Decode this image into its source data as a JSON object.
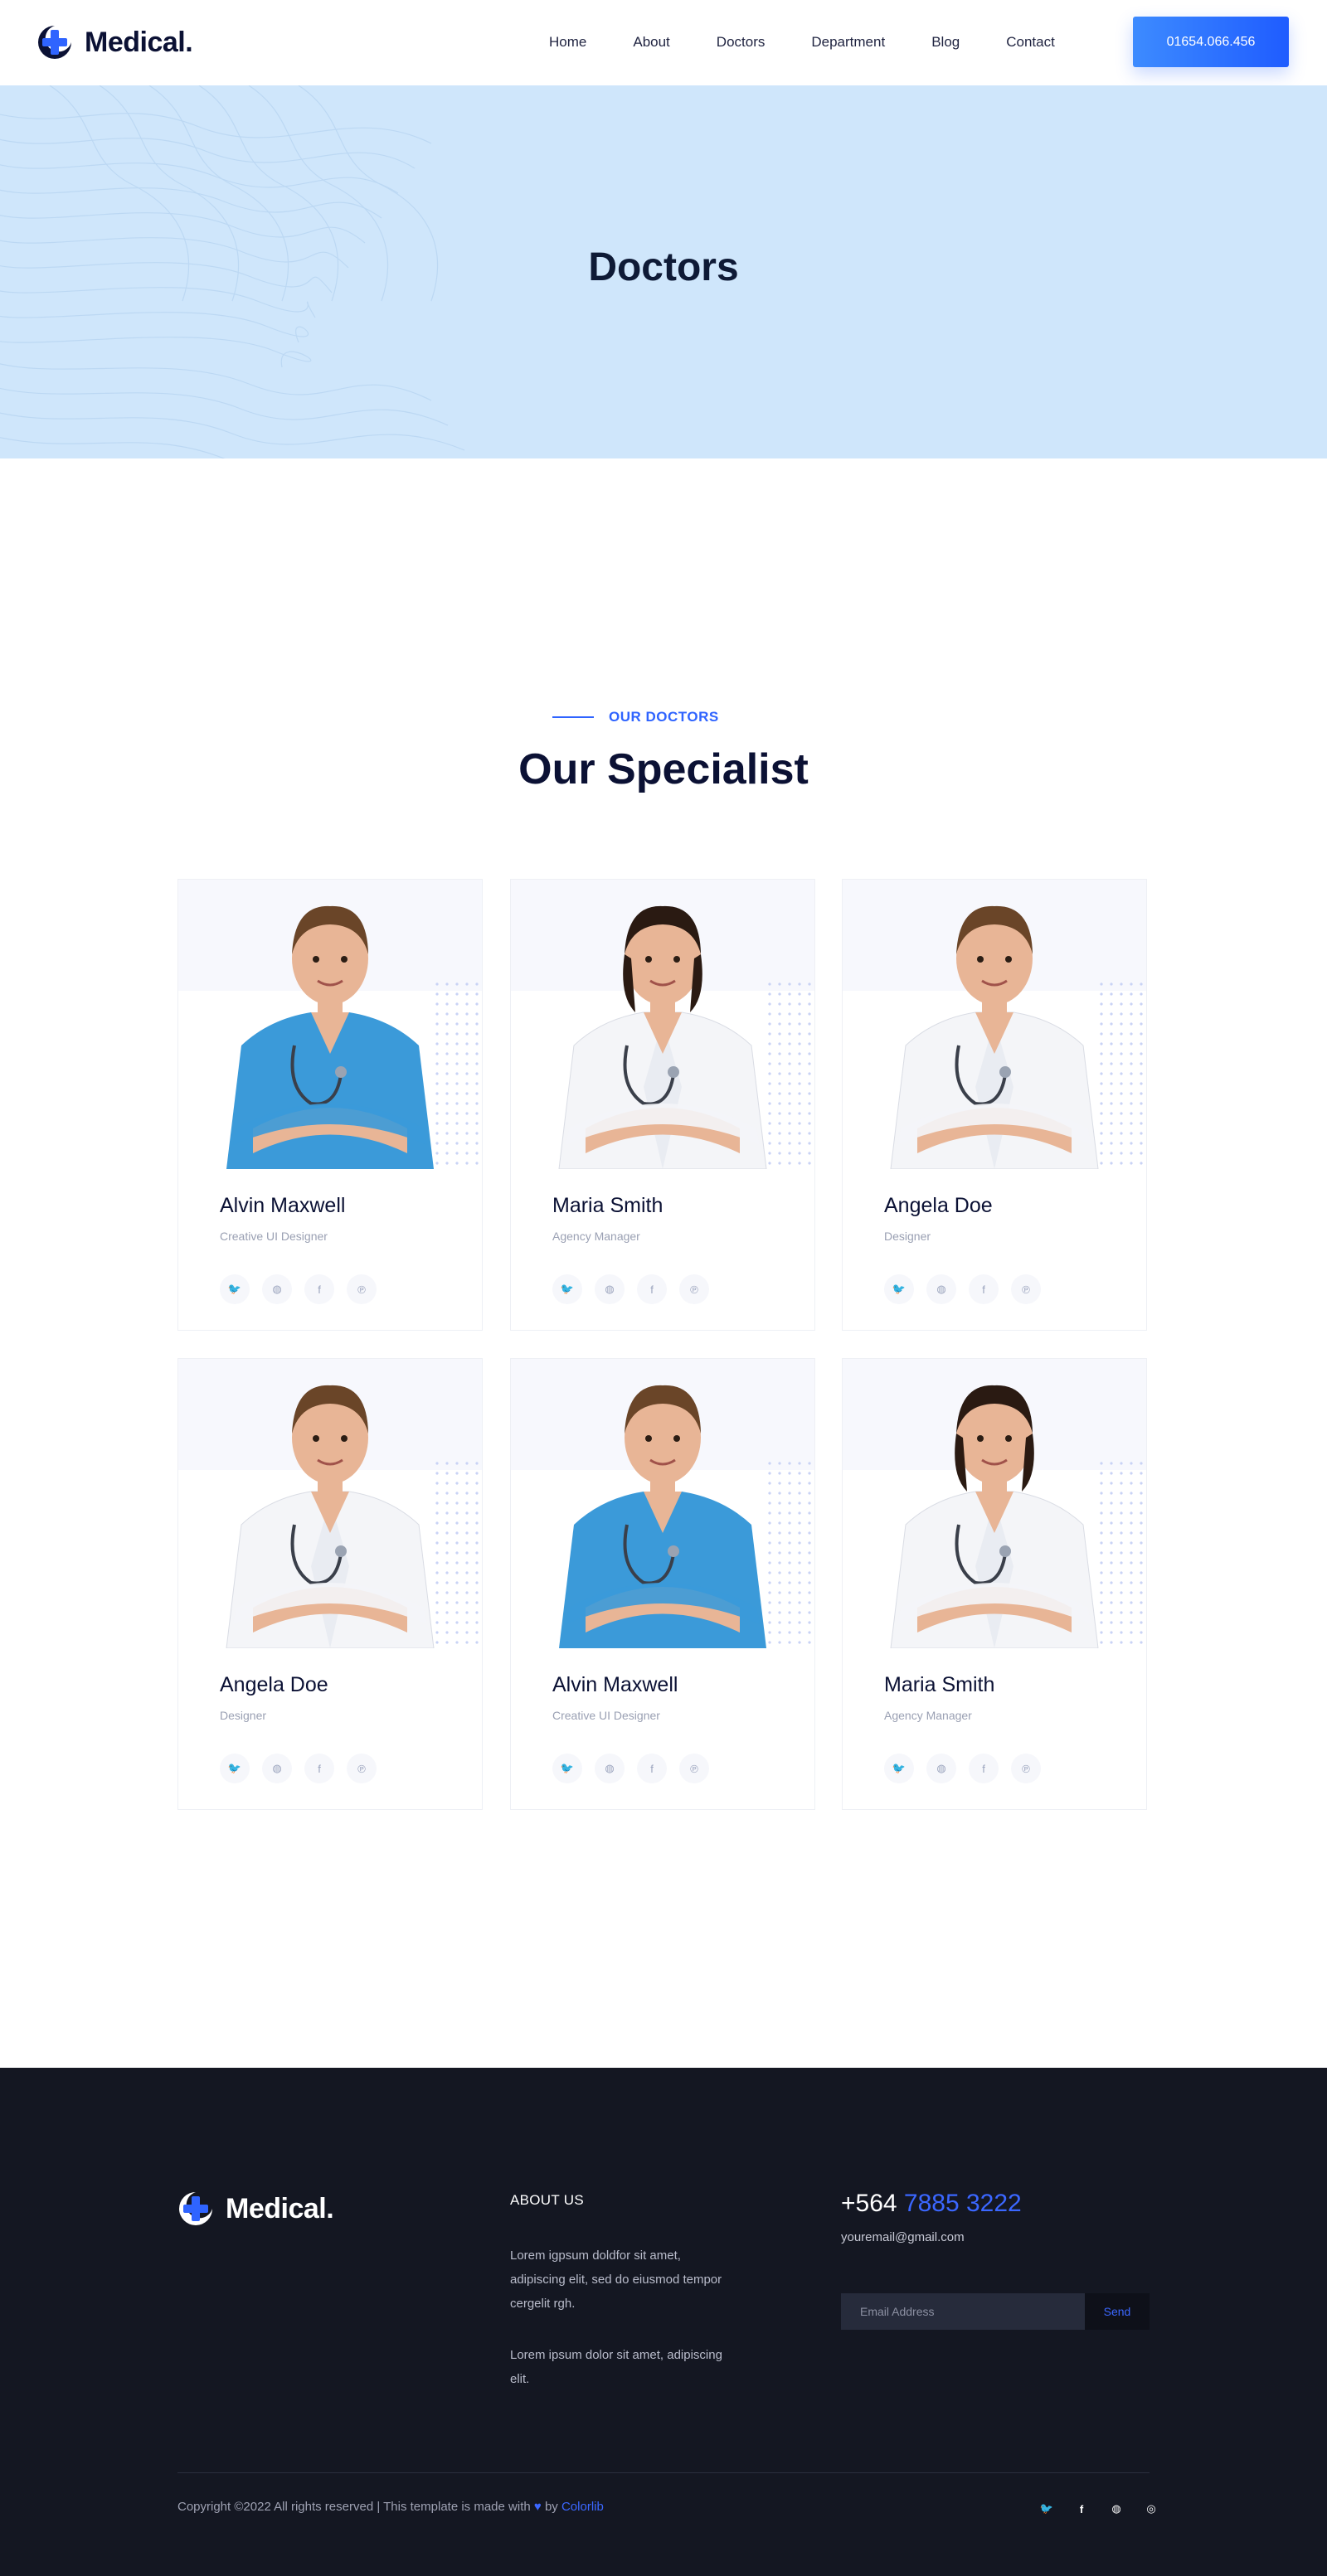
{
  "brand": {
    "name": "Medical."
  },
  "nav": {
    "items": [
      "Home",
      "About",
      "Doctors",
      "Department",
      "Blog",
      "Contact"
    ],
    "phone": "01654.066.456"
  },
  "hero": {
    "title": "Doctors"
  },
  "section": {
    "eyebrow": "OUR DOCTORS",
    "title": "Our Specialist"
  },
  "doctors": [
    {
      "name": "Alvin Maxwell",
      "role": "Creative UI Designer",
      "scrub": "#3b9ad9"
    },
    {
      "name": "Maria Smith",
      "role": "Agency Manager",
      "scrub": "#ffffff"
    },
    {
      "name": "Angela Doe",
      "role": "Designer",
      "scrub": "#ffffff"
    },
    {
      "name": "Angela Doe",
      "role": "Designer",
      "scrub": "#ffffff"
    },
    {
      "name": "Alvin Maxwell",
      "role": "Creative UI Designer",
      "scrub": "#3b9ad9"
    },
    {
      "name": "Maria Smith",
      "role": "Agency Manager",
      "scrub": "#ffffff"
    }
  ],
  "social_icons": [
    "twitter-icon",
    "dribbble-icon",
    "facebook-icon",
    "pinterest-icon"
  ],
  "footer": {
    "about_heading": "ABOUT US",
    "about_p1": "Lorem igpsum doldfor sit amet, adipiscing elit, sed do eiusmod tempor cergelit rgh.",
    "about_p2": "Lorem ipsum dolor sit amet, adipiscing elit.",
    "phone_prefix": "+564",
    "phone_number": "7885 3222",
    "email": "youremail@gmail.com",
    "email_placeholder": "Email Address",
    "send_label": "Send",
    "copyright_pre": "Copyright ©2022 All rights reserved | This template is made with",
    "copyright_by": "by",
    "copyright_link": "Colorlib",
    "social_icons": [
      "twitter-icon",
      "facebook-icon",
      "dribbble-icon",
      "instagram-icon"
    ]
  },
  "colors": {
    "accent": "#2f64ff",
    "hero_bg": "#cfe6fb",
    "footer_bg": "#141722",
    "text_dark": "#0b1134"
  }
}
